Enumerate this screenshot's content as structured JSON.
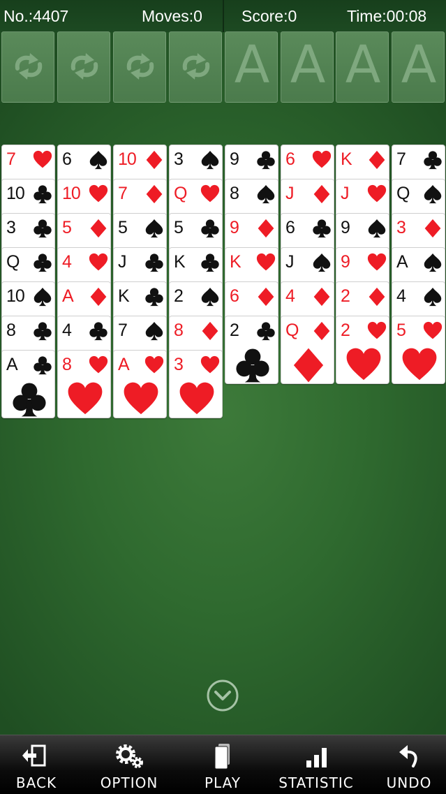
{
  "header": {
    "game_no": "No.:4407",
    "moves": "Moves:0",
    "score": "Score:0",
    "time": "Time:00:08"
  },
  "free_cells": [
    {
      "icon": "cycle-arrows-icon"
    },
    {
      "icon": "cycle-arrows-icon"
    },
    {
      "icon": "cycle-arrows-icon"
    },
    {
      "icon": "cycle-arrows-icon"
    }
  ],
  "foundations": [
    {
      "label": "A"
    },
    {
      "label": "A"
    },
    {
      "label": "A"
    },
    {
      "label": "A"
    }
  ],
  "tableau": [
    [
      {
        "rank": "7",
        "suit": "hearts"
      },
      {
        "rank": "10",
        "suit": "clubs"
      },
      {
        "rank": "3",
        "suit": "clubs"
      },
      {
        "rank": "Q",
        "suit": "clubs"
      },
      {
        "rank": "10",
        "suit": "spades"
      },
      {
        "rank": "8",
        "suit": "clubs"
      },
      {
        "rank": "A",
        "suit": "clubs"
      }
    ],
    [
      {
        "rank": "6",
        "suit": "spades"
      },
      {
        "rank": "10",
        "suit": "hearts"
      },
      {
        "rank": "5",
        "suit": "diamonds"
      },
      {
        "rank": "4",
        "suit": "hearts"
      },
      {
        "rank": "A",
        "suit": "diamonds"
      },
      {
        "rank": "4",
        "suit": "clubs"
      },
      {
        "rank": "8",
        "suit": "hearts"
      }
    ],
    [
      {
        "rank": "10",
        "suit": "diamonds"
      },
      {
        "rank": "7",
        "suit": "diamonds"
      },
      {
        "rank": "5",
        "suit": "spades"
      },
      {
        "rank": "J",
        "suit": "clubs"
      },
      {
        "rank": "K",
        "suit": "clubs"
      },
      {
        "rank": "7",
        "suit": "spades"
      },
      {
        "rank": "A",
        "suit": "hearts"
      }
    ],
    [
      {
        "rank": "3",
        "suit": "spades"
      },
      {
        "rank": "Q",
        "suit": "hearts"
      },
      {
        "rank": "5",
        "suit": "clubs"
      },
      {
        "rank": "K",
        "suit": "clubs"
      },
      {
        "rank": "2",
        "suit": "spades"
      },
      {
        "rank": "8",
        "suit": "diamonds"
      },
      {
        "rank": "3",
        "suit": "hearts"
      }
    ],
    [
      {
        "rank": "9",
        "suit": "clubs"
      },
      {
        "rank": "8",
        "suit": "spades"
      },
      {
        "rank": "9",
        "suit": "diamonds"
      },
      {
        "rank": "K",
        "suit": "hearts"
      },
      {
        "rank": "6",
        "suit": "diamonds"
      },
      {
        "rank": "2",
        "suit": "clubs"
      }
    ],
    [
      {
        "rank": "6",
        "suit": "hearts"
      },
      {
        "rank": "J",
        "suit": "diamonds"
      },
      {
        "rank": "6",
        "suit": "clubs"
      },
      {
        "rank": "J",
        "suit": "spades"
      },
      {
        "rank": "4",
        "suit": "diamonds"
      },
      {
        "rank": "Q",
        "suit": "diamonds"
      }
    ],
    [
      {
        "rank": "K",
        "suit": "diamonds"
      },
      {
        "rank": "J",
        "suit": "hearts"
      },
      {
        "rank": "9",
        "suit": "spades"
      },
      {
        "rank": "9",
        "suit": "hearts"
      },
      {
        "rank": "2",
        "suit": "diamonds"
      },
      {
        "rank": "2",
        "suit": "hearts"
      }
    ],
    [
      {
        "rank": "7",
        "suit": "clubs"
      },
      {
        "rank": "Q",
        "suit": "spades"
      },
      {
        "rank": "3",
        "suit": "diamonds"
      },
      {
        "rank": "A",
        "suit": "spades"
      },
      {
        "rank": "4",
        "suit": "spades"
      },
      {
        "rank": "5",
        "suit": "hearts"
      }
    ]
  ],
  "colors": {
    "red_suit": "#ee1c25",
    "black_suit": "#111111",
    "felt": "#2f6a2f"
  },
  "scroll_down_icon": "chevron-down-circle-icon",
  "toolbar": [
    {
      "label": "BACK",
      "icon": "exit-icon"
    },
    {
      "label": "OPTION",
      "icon": "gears-icon"
    },
    {
      "label": "PLAY",
      "icon": "cards-icon"
    },
    {
      "label": "STATISTIC",
      "icon": "bar-chart-icon"
    },
    {
      "label": "UNDO",
      "icon": "undo-icon"
    }
  ]
}
